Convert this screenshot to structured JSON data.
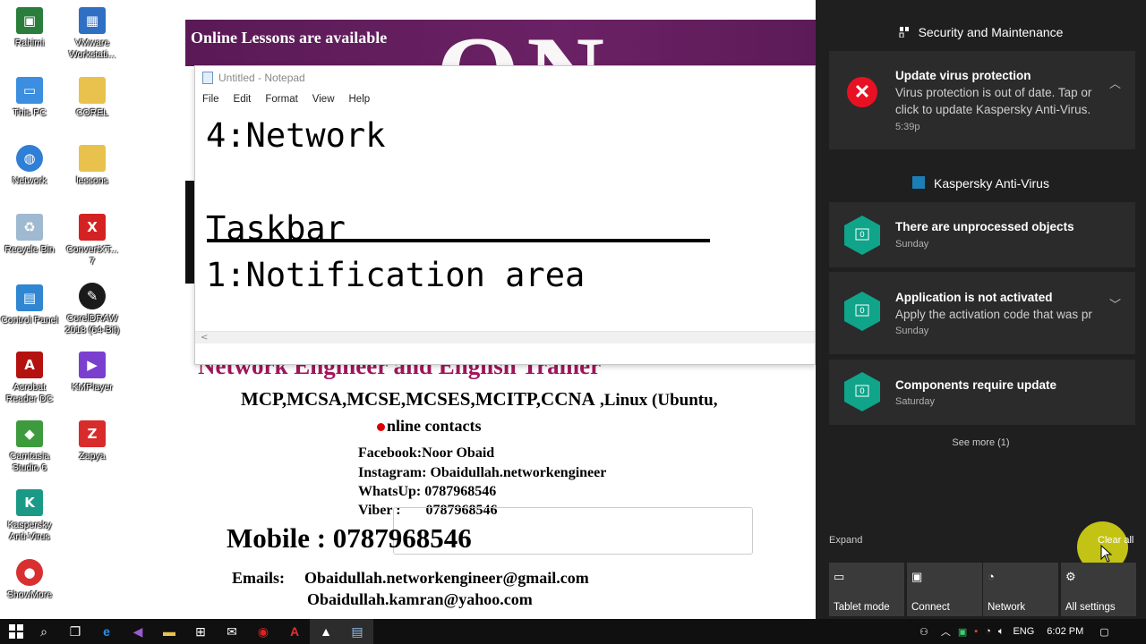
{
  "desktop": {
    "icons": [
      {
        "label": "Rahimi",
        "icon": "monitor-icon",
        "color": "#2a7d3a"
      },
      {
        "label": "VMware Workstati...",
        "icon": "vmware-icon",
        "color": "#2f6fc4"
      },
      {
        "label": "This PC",
        "icon": "computer-icon",
        "color": "#3b8ee0"
      },
      {
        "label": "COREL",
        "icon": "folder-icon",
        "color": "#e8c24d"
      },
      {
        "label": "Network",
        "icon": "network-icon",
        "color": "#2f7fd6"
      },
      {
        "label": "lessons",
        "icon": "folder-icon",
        "color": "#e8c24d"
      },
      {
        "label": "Recycle Bin",
        "icon": "recycle-bin-icon",
        "color": "#9fb9d0"
      },
      {
        "label": "ConvertXT... 7",
        "icon": "convertx-icon",
        "color": "#d42222"
      },
      {
        "label": "Control Panel",
        "icon": "control-panel-icon",
        "color": "#2f86d1"
      },
      {
        "label": "CorelDRAW 2018 (64-Bit)",
        "icon": "coreldraw-icon",
        "color": "#1a1a1a"
      },
      {
        "label": "Acrobat Reader DC",
        "icon": "acrobat-icon",
        "color": "#b3120f"
      },
      {
        "label": "KMPlayer",
        "icon": "kmplayer-icon",
        "color": "#7b3fd0"
      },
      {
        "label": "Camtasia Studio 6",
        "icon": "camtasia-icon",
        "color": "#3d9a3d"
      },
      {
        "label": "Zapya",
        "icon": "zapya-icon",
        "color": "#d82b2b"
      },
      {
        "label": "Kaspersky Anti-Virus",
        "icon": "kaspersky-icon",
        "color": "#1a9a86"
      },
      {
        "label": "ShowMore",
        "icon": "showmore-icon",
        "color": "#d83030"
      }
    ]
  },
  "slide": {
    "banner": "Online Lessons are available",
    "big_letters": "ON",
    "trainer": "Network Engineer and English Trainer",
    "certs": "MCP,MCSA,MCSE,MCSES,MCITP,CCNA",
    "certs_linux": ",Linux (Ubuntu,",
    "online_contacts": "nline contacts",
    "facebook": "Facebook:Noor Obaid",
    "instagram": "Instagram: Obaidullah.networkengineer",
    "whatsapp": "WhatsUp: 0787968546",
    "viber": "Viber :       0787968546",
    "mobile": "Mobile : 0787968546",
    "emails_label": "Emails:",
    "email1": "Obaidullah.networkengineer@gmail.com",
    "email2": "Obaidullah.kamran@yahoo.com"
  },
  "notepad": {
    "title": "Untitled - Notepad",
    "menu": [
      "File",
      "Edit",
      "Format",
      "View",
      "Help"
    ],
    "line1": "4:Network",
    "line2": "Taskbar",
    "line3": "1:Notification area",
    "scroll_arrow": "<"
  },
  "action_center": {
    "group1": "Security and Maintenance",
    "n1_title": "Update virus protection",
    "n1_body": "Virus protection is out of date. Tap or click to update Kaspersky Anti-Virus.",
    "n1_time": "5:39p",
    "group2": "Kaspersky Anti-Virus",
    "n2_title": "There are unprocessed objects",
    "n2_time": "Sunday",
    "n3_title": "Application is not activated",
    "n3_body": "Apply the activation code that was pr",
    "n3_time": "Sunday",
    "n4_title": "Components require update",
    "n4_time": "Saturday",
    "kav_badge": "0",
    "see_more": "See more (1)",
    "expand": "Expand",
    "clear_all": "Clear all",
    "quick_actions": [
      {
        "label": "Tablet mode",
        "icon": "tablet-mode-icon"
      },
      {
        "label": "Connect",
        "icon": "connect-icon"
      },
      {
        "label": "Network",
        "icon": "network-icon"
      },
      {
        "label": "All settings",
        "icon": "settings-icon"
      }
    ]
  },
  "taskbar": {
    "lang": "ENG",
    "time": "6:02 PM"
  }
}
